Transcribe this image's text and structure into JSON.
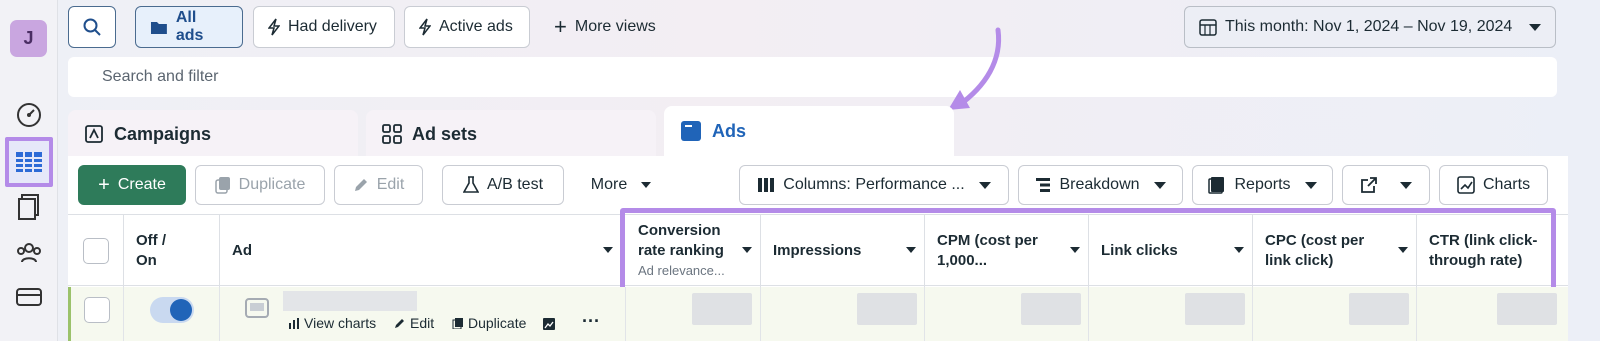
{
  "user": {
    "initial": "J"
  },
  "toolbar": {
    "all_ads": "All ads",
    "had_delivery": "Had delivery",
    "active_ads": "Active ads",
    "more_views": "More views",
    "date_range": "This month: Nov 1, 2024 – Nov 19, 2024"
  },
  "search": {
    "placeholder": "Search and filter"
  },
  "tabs": {
    "campaigns": "Campaigns",
    "ad_sets": "Ad sets",
    "ads": "Ads"
  },
  "actions": {
    "create": "Create",
    "duplicate": "Duplicate",
    "edit": "Edit",
    "ab_test": "A/B test",
    "more": "More",
    "columns": "Columns: Performance ...",
    "breakdown": "Breakdown",
    "reports": "Reports",
    "charts": "Charts"
  },
  "table": {
    "headers": {
      "off_on": "Off /\nOn",
      "ad": "Ad",
      "conversion_rate": "Conversion rate ranking",
      "conversion_sub": "Ad relevance...",
      "impressions": "Impressions",
      "cpm": "CPM (cost per 1,000...",
      "link_clicks": "Link clicks",
      "cpc": "CPC (cost per link click)",
      "ctr": "CTR (link click-through rate)"
    },
    "row": {
      "view_charts": "View charts",
      "edit": "Edit",
      "duplicate": "Duplicate",
      "toggle_on": true
    }
  },
  "colors": {
    "highlight": "#b48be8",
    "create": "#2e7b5a",
    "active_tab": "#2064b8"
  }
}
